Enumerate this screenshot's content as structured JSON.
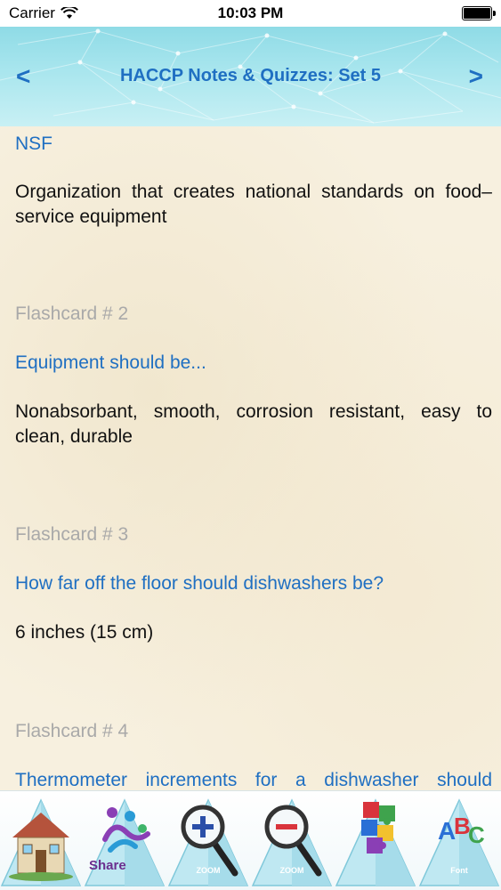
{
  "status": {
    "carrier": "Carrier",
    "time": "10:03 PM"
  },
  "nav": {
    "title": "HACCP Notes & Quizzes: Set 5",
    "prev": "<",
    "next": ">"
  },
  "cards": {
    "card1": {
      "question": "NSF",
      "answer": "Organization that creates national standards on food–service equipment"
    },
    "card2": {
      "label": "Flashcard # 2",
      "question": "Equipment should be...",
      "answer": "Nonabsorbant, smooth, corrosion resistant, easy to clean, durable"
    },
    "card3": {
      "label": "Flashcard # 3",
      "question": "How far off the floor should dishwashers be?",
      "answer": "6 inches (15 cm)"
    },
    "card4": {
      "label": "Flashcard # 4",
      "question": "Thermometer increments for a dishwasher should"
    }
  },
  "tabbar": {
    "share_label": "Share",
    "zoom_in_label": "ZOOM",
    "zoom_out_label": "ZOOM",
    "font_label": "Font"
  },
  "colors": {
    "accent": "#1f6fc2",
    "answer_text": "#111111",
    "flashcard_label": "#a9a9a9",
    "background": "#f7f0df",
    "nav_bg": "#a9e6ee"
  },
  "icons": {
    "tab1": "home-icon",
    "tab2": "share-icon",
    "tab3": "zoom-in-icon",
    "tab4": "zoom-out-icon",
    "tab5": "puzzle-icon",
    "tab6": "abc-icon"
  }
}
